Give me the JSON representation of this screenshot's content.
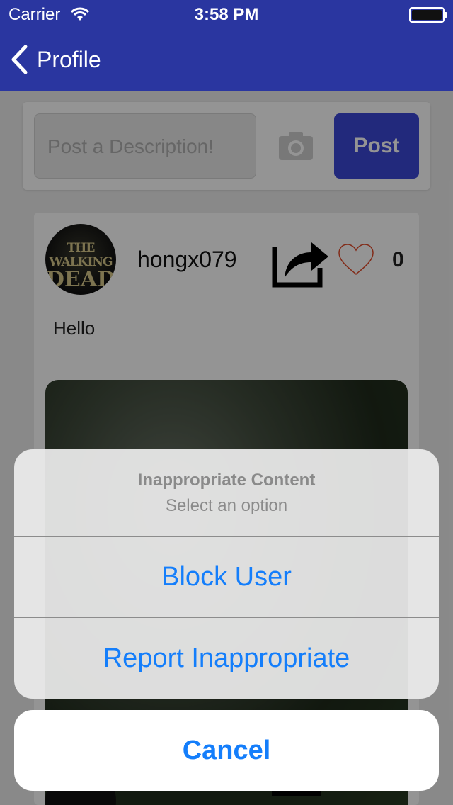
{
  "status_bar": {
    "carrier": "Carrier",
    "time": "3:58 PM"
  },
  "nav": {
    "back_label": "Profile"
  },
  "composer": {
    "placeholder": "Post a Description!",
    "post_label": "Post"
  },
  "post": {
    "avatar_text_1": "THE WALKING",
    "avatar_text_2": "DEAD",
    "username": "hongx079",
    "likes": "0",
    "caption": "Hello"
  },
  "action_sheet": {
    "title": "Inappropriate Content",
    "message": "Select an option",
    "actions": [
      "Block User",
      "Report Inappropriate"
    ],
    "cancel": "Cancel"
  },
  "colors": {
    "nav_bg": "#2a36a0",
    "post_button": "#3b47d6",
    "ios_blue": "#147efb",
    "heart": "#e04a2a"
  },
  "icons": [
    "wifi-icon",
    "battery-icon",
    "chevron-left-icon",
    "camera-icon",
    "share-icon",
    "heart-icon"
  ]
}
